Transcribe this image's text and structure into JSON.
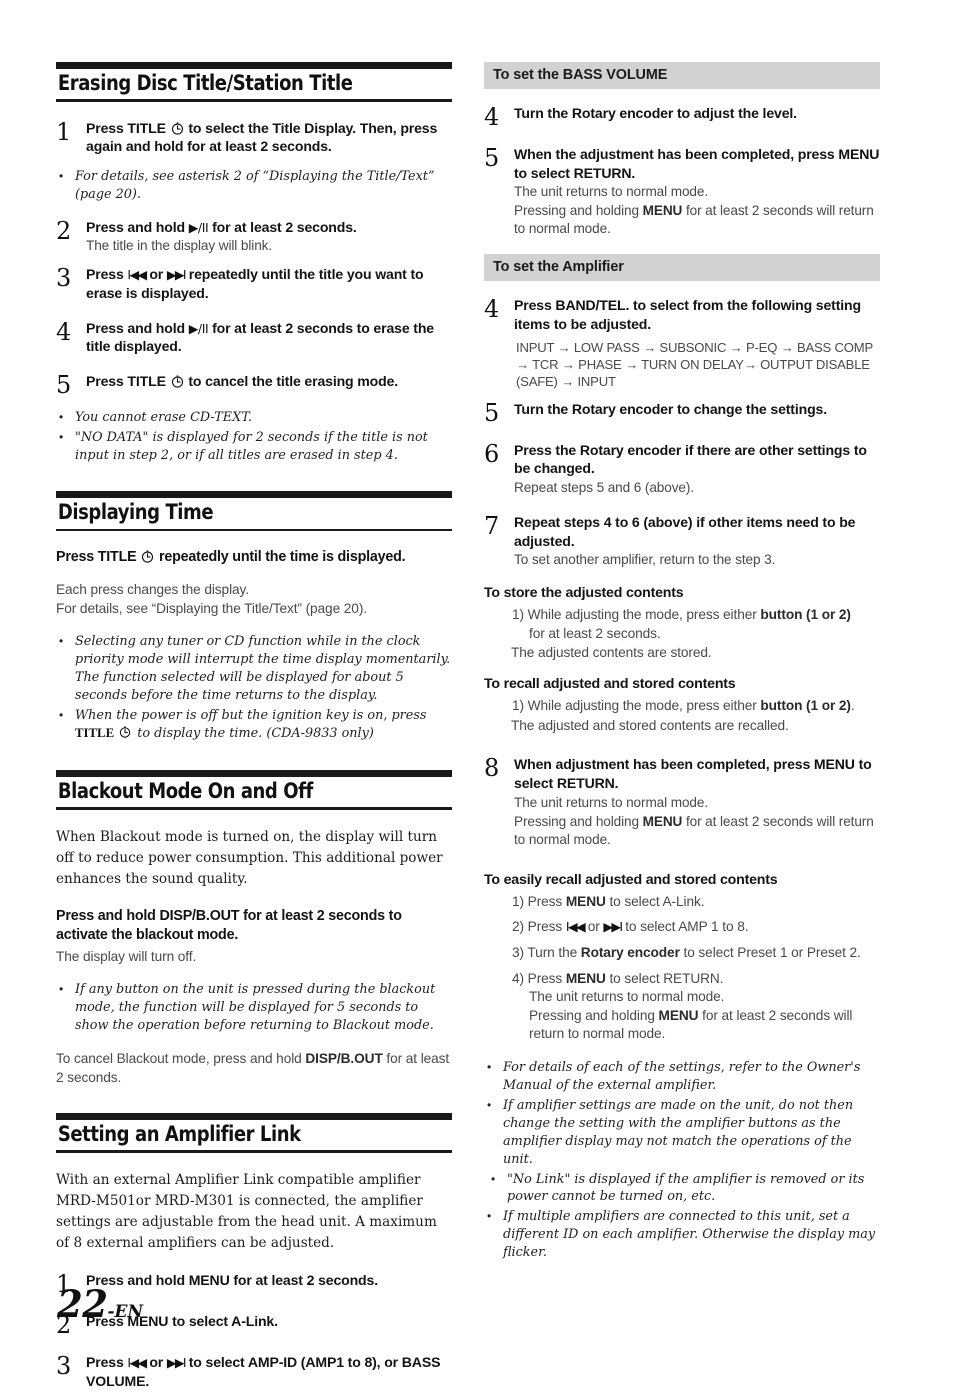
{
  "page": {
    "number": "22",
    "suffix": "-EN"
  },
  "left_column": {
    "sections": [
      {
        "heading": "Erasing Disc Title/Station Title",
        "steps": [
          {
            "num": "1",
            "lead_a": "Press ",
            "lead_b": "TITLE",
            "icon": "clock-icon",
            "lead_c": " to select the Title Display. Then, press again and hold for at least 2 seconds."
          },
          {
            "num": "2",
            "lead_a": "Press and hold ",
            "glyph": "▶/II",
            "lead_c": " for at least 2 seconds.",
            "sub": "The title in the display will blink."
          },
          {
            "num": "3",
            "lead_a": "Press ",
            "glyph": "I◀◀",
            "lead_mid": " or ",
            "glyph2": "▶▶I",
            "lead_c": " repeatedly until the title you want to erase is displayed."
          },
          {
            "num": "4",
            "lead_a": "Press and hold ",
            "glyph": "▶/II",
            "lead_c": " for at least 2 seconds to erase the title displayed."
          },
          {
            "num": "5",
            "lead_a": "Press ",
            "lead_b": "TITLE",
            "icon": "clock-icon",
            "lead_c": " to cancel the title erasing mode."
          }
        ],
        "note_after_step1": "For details, see asterisk 2 of “Displaying the Title/Text” (page 20).",
        "notes_end": [
          "You cannot erase CD-TEXT.",
          "\"NO DATA\" is displayed for 2 seconds if the title is not input in step 2, or if all titles are erased in step 4."
        ]
      },
      {
        "heading": "Displaying Time",
        "lead_a": "Press ",
        "lead_b": "TITLE",
        "lead_c": " repeatedly until the time is displayed.",
        "body_lines": [
          "Each press changes the display.",
          "For details, see “Displaying the Title/Text” (page 20)."
        ],
        "notes": [
          "Selecting any tuner or CD function while in the clock priority mode will interrupt the time display momentarily. The function selected will be displayed for about 5 seconds before the time returns to the display.",
          "When the power is off but the ignition key is on, press TITLE Ⓘ to display the time. (CDA-9833 only)"
        ],
        "note2_pre": "When the power is off but the ignition key is on, press ",
        "note2_bold": "TITLE",
        "note2_post": " to display the time. (CDA-9833 only)"
      },
      {
        "heading": "Blackout Mode On and Off",
        "intro": "When Blackout mode is turned on, the display will turn off to reduce power consumption. This additional power enhances the sound quality.",
        "lead_a": "Press and hold ",
        "lead_b": "DISP/B.OUT",
        "lead_c": " for at least 2 seconds to activate the blackout mode.",
        "sub": "The display will turn off.",
        "note": "If any button on the unit is pressed during the blackout mode, the function will be displayed for 5 seconds to show the operation before returning to Blackout mode.",
        "closing_a": "To cancel Blackout mode, press and hold ",
        "closing_b": "DISP/B.OUT",
        "closing_c": " for at least 2 seconds."
      },
      {
        "heading": "Setting an Amplifier Link",
        "intro": "With an external Amplifier Link compatible amplifier MRD-M501or MRD-M301 is connected, the amplifier settings are adjustable from the head unit. A maximum of 8 external amplifiers can be adjusted.",
        "steps": [
          {
            "num": "1",
            "lead_a": "Press and hold ",
            "lead_b": "MENU",
            "lead_c": " for at least 2 seconds."
          },
          {
            "num": "2",
            "lead_a": "Press ",
            "lead_b": "MENU",
            "lead_c": " to select A-Link."
          },
          {
            "num": "3",
            "lead_a": "Press ",
            "glyph": "I◀◀",
            "lead_mid": " or ",
            "glyph2": "▶▶I",
            "lead_c": " to select AMP-ID (AMP1 to 8), or BASS VOLUME."
          }
        ]
      }
    ]
  },
  "right_column": {
    "band_bass": "To set the BASS VOLUME",
    "bass_steps": [
      {
        "num": "4",
        "lead_a": "Turn the ",
        "lead_b": "Rotary encoder",
        "lead_c": " to adjust the level."
      },
      {
        "num": "5",
        "lead_a": "When the adjustment has been completed, press ",
        "lead_b": "MENU",
        "lead_c": " to select RETURN.",
        "sub_lines": [
          "The unit returns to normal mode.",
          "Pressing and holding MENU for at least 2 seconds will return to normal mode."
        ],
        "sub_bold": "MENU"
      }
    ],
    "band_amp": "To set the Amplifier",
    "amp_steps": [
      {
        "num": "4",
        "lead_a": "Press ",
        "lead_b": "BAND/TEL.",
        "lead_c": " to select from the following setting items to be adjusted.",
        "flow": "INPUT → LOW PASS → SUBSONIC → P-EQ → BASS COMP → TCR → PHASE → TURN ON DELAY→  OUTPUT DISABLE (SAFE) → INPUT"
      },
      {
        "num": "5",
        "lead_a": "Turn the ",
        "lead_b": "Rotary encoder",
        "lead_c": " to change the settings."
      },
      {
        "num": "6",
        "lead_a": "Press the ",
        "lead_b": "Rotary encoder",
        "lead_c": " if there are other settings to be changed.",
        "sub": "Repeat steps 5 and 6 (above)."
      },
      {
        "num": "7",
        "lead_a": "Repeat steps 4 to 6 (above) if other items need to be adjusted.",
        "sub": "To set another amplifier, return to the step 3."
      }
    ],
    "store_head": "To store the adjusted contents",
    "store_item_a": "1) While adjusting the mode, press either ",
    "store_item_b": "button (1 or 2)",
    "store_item_cont": "for at least 2 seconds.",
    "store_after": "The adjusted contents are stored.",
    "recall_head": "To recall adjusted and stored contents",
    "recall_item_a": "1) While adjusting the mode, press either ",
    "recall_item_b": "button (1 or 2)",
    "recall_item_c": ".",
    "recall_after": "The adjusted and stored contents are recalled.",
    "step8": {
      "num": "8",
      "lead_a": "When adjustment has been completed, press ",
      "lead_b": "MENU",
      "lead_c": " to select RETURN.",
      "sub_lines": [
        "The unit returns to normal mode.",
        "Pressing and holding MENU for at least 2 seconds will return to normal mode."
      ],
      "sub_bold": "MENU"
    },
    "easy_head": "To easily recall adjusted and stored contents",
    "easy_items": [
      {
        "n": "1) Press ",
        "b": "MENU",
        "t": " to select A-Link."
      },
      {
        "n": "2) Press ",
        "g1": "I◀◀",
        "mid": " or ",
        "g2": "▶▶I",
        "t": " to select AMP 1 to 8."
      },
      {
        "n": "3) Turn the ",
        "b": "Rotary encoder",
        "t": " to select Preset 1 or Preset 2."
      },
      {
        "n": "4) Press ",
        "b": "MENU",
        "t": " to select RETURN."
      }
    ],
    "easy_sub_lines": [
      "The unit returns to normal mode.",
      "Pressing and holding MENU for at least 2 seconds will return to normal mode."
    ],
    "notes": [
      "For details of each of the settings, refer to the Owner's Manual of the external amplifier.",
      "If amplifier settings are made on the unit, do not then change the setting with the amplifier buttons as the amplifier display may not match the operations of the unit.",
      "\"No Link\" is displayed if the amplifier is removed or its power cannot be turned on, etc.",
      "If multiple amplifiers are connected to this unit, set a different ID on each amplifier. Otherwise the display may flicker."
    ]
  },
  "colors": {
    "band_gray": "#d2d2d2",
    "rule_black": "#1a1a1a",
    "sub_text": "#4a4a4a"
  }
}
